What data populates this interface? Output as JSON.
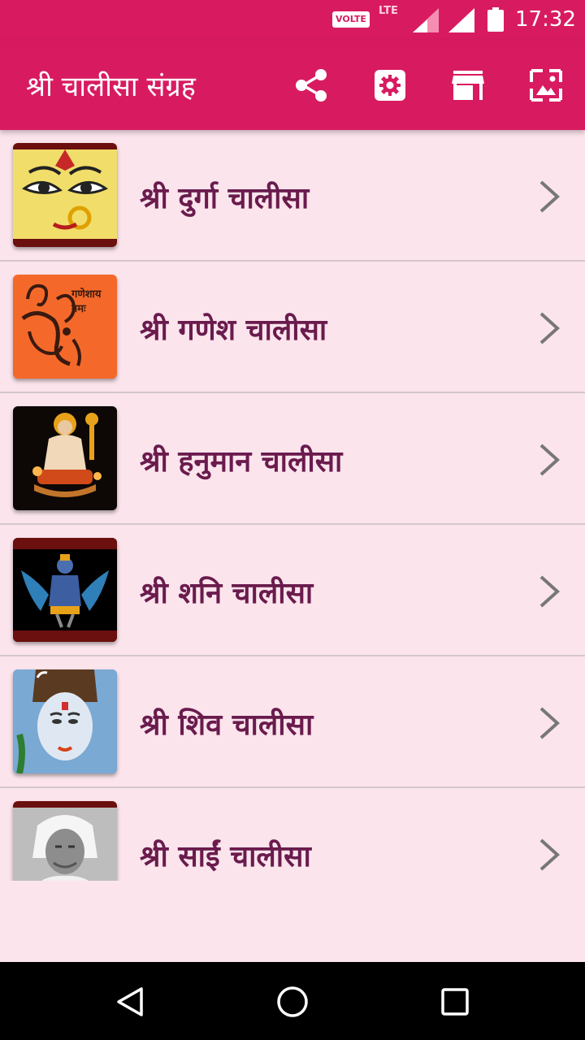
{
  "status_bar": {
    "volte": "VOLTE",
    "lte": "LTE",
    "time": "17:32"
  },
  "app_bar": {
    "title": "श्री चालीसा संग्रह",
    "actions": [
      "share-icon",
      "settings-icon",
      "store-icon",
      "wallpaper-icon"
    ]
  },
  "list": {
    "items": [
      {
        "label": "श्री दुर्गा चालीसा",
        "thumb": "durga-image"
      },
      {
        "label": "श्री गणेश चालीसा",
        "thumb": "ganesh-image",
        "thumb_text": "गणेशाय नमः"
      },
      {
        "label": "श्री हनुमान चालीसा",
        "thumb": "hanuman-image"
      },
      {
        "label": "श्री शनि चालीसा",
        "thumb": "shani-image"
      },
      {
        "label": "श्री शिव चालीसा",
        "thumb": "shiva-image"
      },
      {
        "label": "श्री साईं चालीसा",
        "thumb": "sai-image"
      }
    ]
  },
  "colors": {
    "primary": "#d81b60",
    "background": "#fbe4ec",
    "label": "#6a1b4d"
  },
  "nav_bar": {
    "buttons": [
      "back-icon",
      "home-icon",
      "recents-icon"
    ]
  }
}
